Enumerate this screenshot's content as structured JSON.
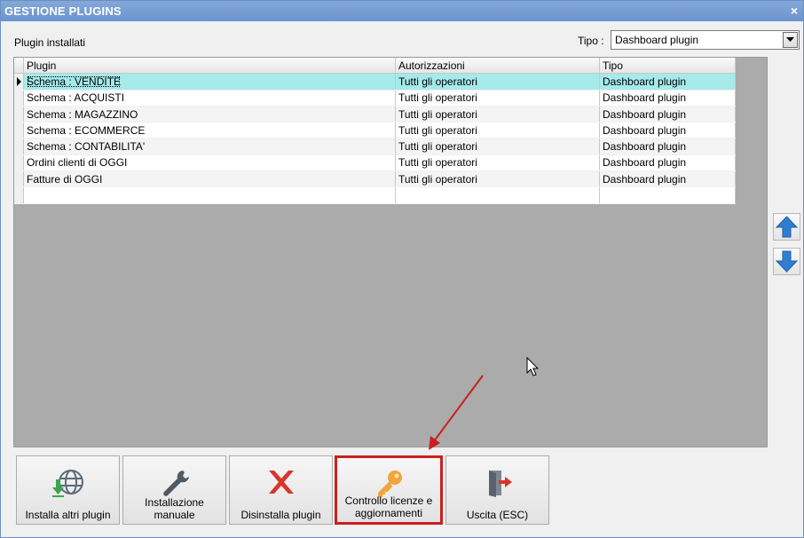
{
  "window": {
    "title": "GESTIONE PLUGINS",
    "close_glyph": "×"
  },
  "labels": {
    "installed": "Plugin installati",
    "tipo": "Tipo :"
  },
  "filter": {
    "selected": "Dashboard plugin"
  },
  "grid": {
    "headers": [
      "Plugin",
      "Autorizzazioni",
      "Tipo"
    ],
    "rows": [
      {
        "plugin": "Schema : VENDITE",
        "auth": "Tutti gli operatori",
        "tipo": "Dashboard plugin"
      },
      {
        "plugin": "Schema : ACQUISTI",
        "auth": "Tutti gli operatori",
        "tipo": "Dashboard plugin"
      },
      {
        "plugin": "Schema : MAGAZZINO",
        "auth": "Tutti gli operatori",
        "tipo": "Dashboard plugin"
      },
      {
        "plugin": "Schema : ECOMMERCE",
        "auth": "Tutti gli operatori",
        "tipo": "Dashboard plugin"
      },
      {
        "plugin": "Schema : CONTABILITA'",
        "auth": "Tutti gli operatori",
        "tipo": "Dashboard plugin"
      },
      {
        "plugin": "Ordini clienti di OGGI",
        "auth": "Tutti gli operatori",
        "tipo": "Dashboard plugin"
      },
      {
        "plugin": "Fatture di OGGI",
        "auth": "Tutti gli operatori",
        "tipo": "Dashboard plugin"
      }
    ]
  },
  "buttons": {
    "install_more": "Installa altri plugin",
    "manual_install_1": "Installazione",
    "manual_install_2": "manuale",
    "uninstall": "Disinstalla plugin",
    "license_1": "Controllo licenze e",
    "license_2": "aggiornamenti",
    "exit": "Uscita (ESC)"
  },
  "colors": {
    "titlebar": "#6b94cf",
    "selected_row": "#a6eaea",
    "grid_bg": "#ababab",
    "highlight": "#cc1f1f",
    "arrow_blue": "#2f7fd0"
  }
}
